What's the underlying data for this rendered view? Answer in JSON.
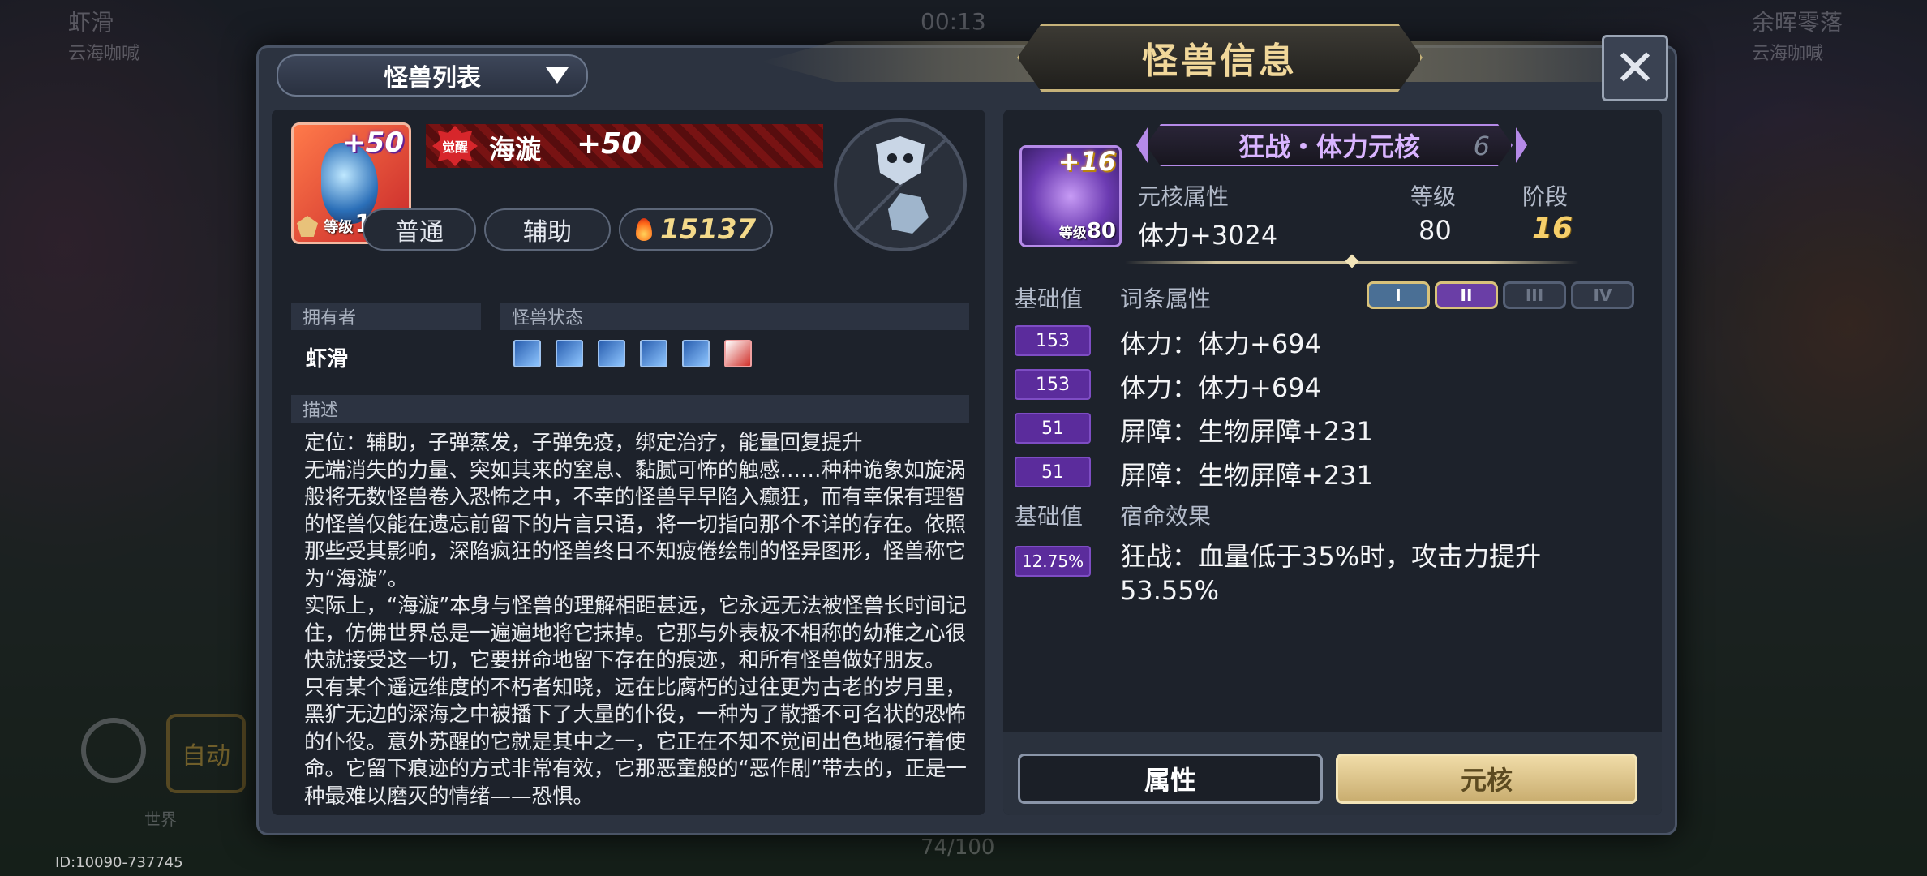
{
  "background": {
    "player_left": "虾滑",
    "guild_left": "云海咖喊",
    "player_right": "余晖零落",
    "guild_right": "云海咖喊",
    "timer": "00:13",
    "auto_label": "自动",
    "chat_tag": "世界",
    "progress": "74/100",
    "id_text": "ID:10090-737745"
  },
  "modal": {
    "title": "怪兽信息",
    "dropdown_label": "怪兽列表",
    "close_icon": "close-x-icon"
  },
  "monster": {
    "plus": "+50",
    "level_label": "等级",
    "level": "130",
    "awaken_label": "觉醒",
    "name": "海漩",
    "awaken_plus": "+50",
    "type1": "普通",
    "type2": "辅助",
    "power": "15137"
  },
  "owner": {
    "header": "拥有者",
    "name": "虾滑"
  },
  "status": {
    "header": "怪兽状态",
    "icons": [
      "status-icon-1",
      "status-icon-2",
      "status-icon-3",
      "status-icon-4",
      "status-icon-5",
      "status-icon-6"
    ]
  },
  "description": {
    "header": "描述",
    "paragraphs": [
      "定位：辅助，子弹蒸发，子弹免疫，绑定治疗，能量回复提升",
      "无端消失的力量、突如其来的窒息、黏腻可怖的触感……种种诡象如旋涡般将无数怪兽卷入恐怖之中，不幸的怪兽早早陷入癫狂，而有幸保有理智的怪兽仅能在遗忘前留下的片言只语，将一切指向那个不详的存在。依照那些受其影响，深陷疯狂的怪兽终日不知疲倦绘制的怪异图形，怪兽称它为“海漩”。",
      "实际上，“海漩”本身与怪兽的理解相距甚远，它永远无法被怪兽长时间记住，仿佛世界总是一遍遍地将它抹掉。它那与外表极不相称的幼稚之心很快就接受这一切，它要拼命地留下存在的痕迹，和所有怪兽做好朋友。",
      "只有某个遥远维度的不朽者知晓，远在比腐朽的过往更为古老的岁月里，黑犷无边的深海之中被播下了大量的仆役，一种为了散播不可名状的恐怖的仆役。意外苏醒的它就是其中之一，它正在不知不觉间出色地履行着使命。它留下痕迹的方式非常有效，它那恶童般的“恶作剧”带去的，正是一种最难以磨灭的情绪——恐惧。"
    ]
  },
  "core": {
    "plus": "+16",
    "level_label": "等级",
    "level": "80",
    "name": "狂战・体力元核",
    "number": "6",
    "attr_label": "元核属性",
    "attr_value": "体力+3024",
    "grade_label": "等级",
    "grade_value": "80",
    "stage_label": "阶段",
    "stage_value": "16",
    "base_label": "基础值",
    "entry_label": "词条属性",
    "tiers": [
      "I",
      "II",
      "III",
      "IV"
    ],
    "entries": [
      {
        "base": "153",
        "text": "体力：体力+694"
      },
      {
        "base": "153",
        "text": "体力：体力+694"
      },
      {
        "base": "51",
        "text": "屏障：生物屏障+231"
      },
      {
        "base": "51",
        "text": "屏障：生物屏障+231"
      }
    ],
    "fate_base_label": "基础值",
    "fate_label": "宿命效果",
    "fate_base": "12.75%",
    "fate_text": "狂战：血量低于35%时，攻击力提升53.55%"
  },
  "tabs": {
    "attr": "属性",
    "core": "元核"
  },
  "colors": {
    "panel": "#1d222b",
    "gold": "#f6cf6a",
    "purple": "#b58ae8",
    "badge_purple": "#5b2c9c"
  }
}
